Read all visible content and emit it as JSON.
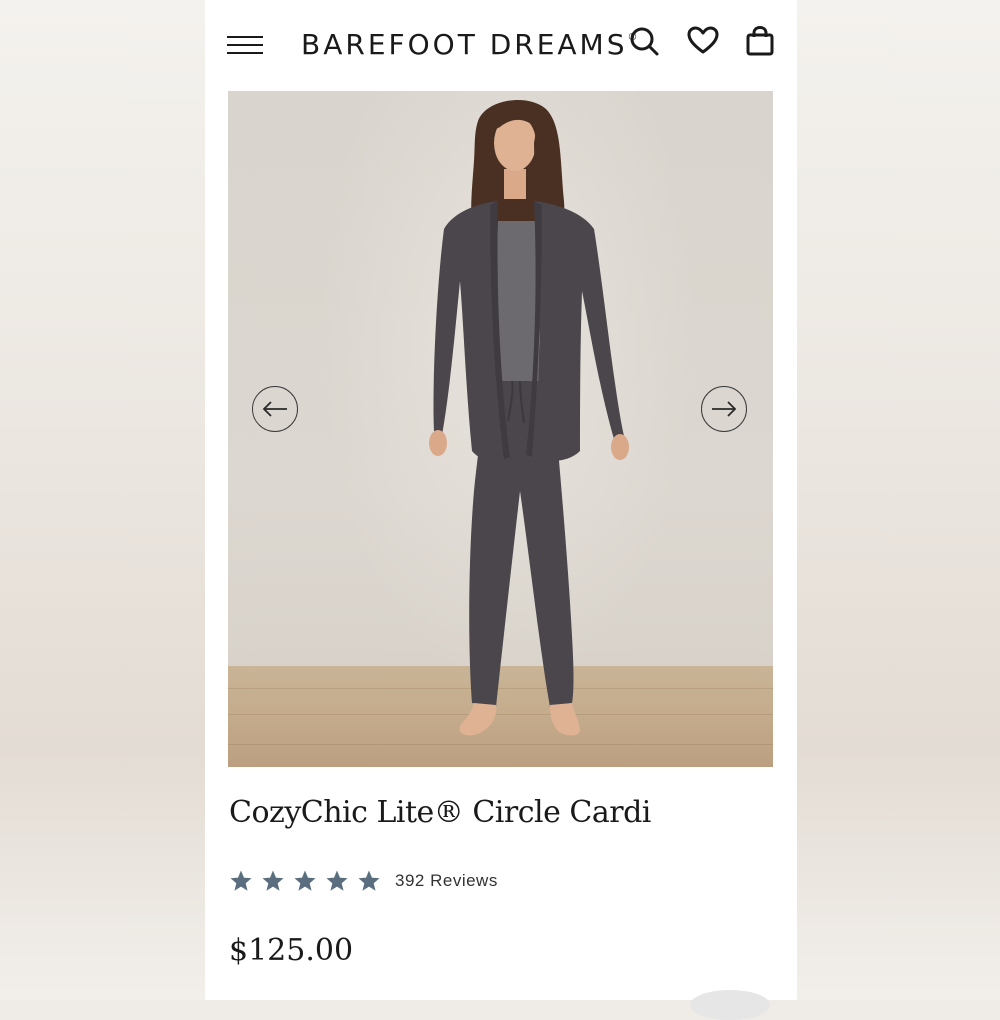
{
  "brand": {
    "logo_text": "BAREFOOT DREAMS",
    "registered_mark": "®"
  },
  "header": {
    "icons": [
      "menu-icon",
      "search-icon",
      "heart-icon",
      "shopping-bag-icon"
    ]
  },
  "product": {
    "title": "CozyChic Lite® Circle Cardi",
    "rating": 5,
    "reviews_label": "392 Reviews",
    "price": "$125.00"
  },
  "carousel": {
    "prev_icon": "arrow-left-icon",
    "next_icon": "arrow-right-icon"
  },
  "colors": {
    "star": "#5a6e7f",
    "garment": "#4a464b",
    "text": "#1a1a1a"
  }
}
